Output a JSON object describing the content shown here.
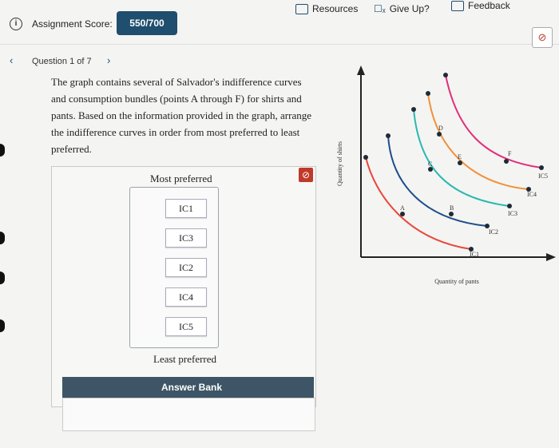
{
  "header": {
    "score_label": "Assignment Score:",
    "score_value": "550/700",
    "resources_label": "Resources",
    "give_up_label": "Give Up?",
    "feedback_label": "Feedback"
  },
  "question": {
    "nav_label": "Question 1 of 7",
    "text": "The graph contains several of Salvador's indifference curves and consumption bundles (points A through F) for shirts and pants. Based on the information provided in the graph, arrange the indifference curves in order from most preferred to least preferred."
  },
  "ranking": {
    "top_label": "Most preferred",
    "bottom_label": "Least preferred",
    "items": [
      "IC1",
      "IC3",
      "IC2",
      "IC4",
      "IC5"
    ]
  },
  "answer_bank": {
    "label": "Answer Bank"
  },
  "graph": {
    "ylabel": "Quantity of shirts",
    "xlabel": "Quantity of pants",
    "curve_labels": [
      "IC1",
      "IC2",
      "IC3",
      "IC4",
      "IC5"
    ],
    "point_labels": [
      "A",
      "B",
      "C",
      "D",
      "E",
      "F"
    ],
    "colors": {
      "IC1": "#e8473c",
      "IC2": "#1f4e8c",
      "IC3": "#2bb9b0",
      "IC4": "#f0913a",
      "IC5": "#e0307a"
    }
  }
}
